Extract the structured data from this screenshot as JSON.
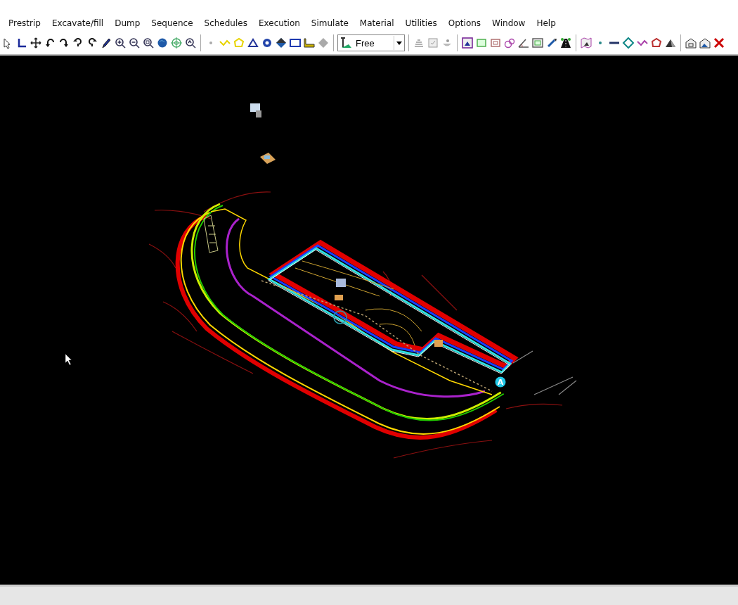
{
  "menu_bar": [
    {
      "label": "Prestrip"
    },
    {
      "label": "Excavate/fill"
    },
    {
      "label": "Dump"
    },
    {
      "label": "Sequence"
    },
    {
      "label": "Schedules"
    },
    {
      "label": "Execution"
    },
    {
      "label": "Simulate"
    },
    {
      "label": "Material"
    },
    {
      "label": "Utilities"
    },
    {
      "label": "Options"
    },
    {
      "label": "Window"
    },
    {
      "label": "Help"
    }
  ],
  "toolbar": {
    "mode_dropdown": {
      "value": "Free"
    }
  },
  "canvas": {
    "marker_label": "A"
  }
}
